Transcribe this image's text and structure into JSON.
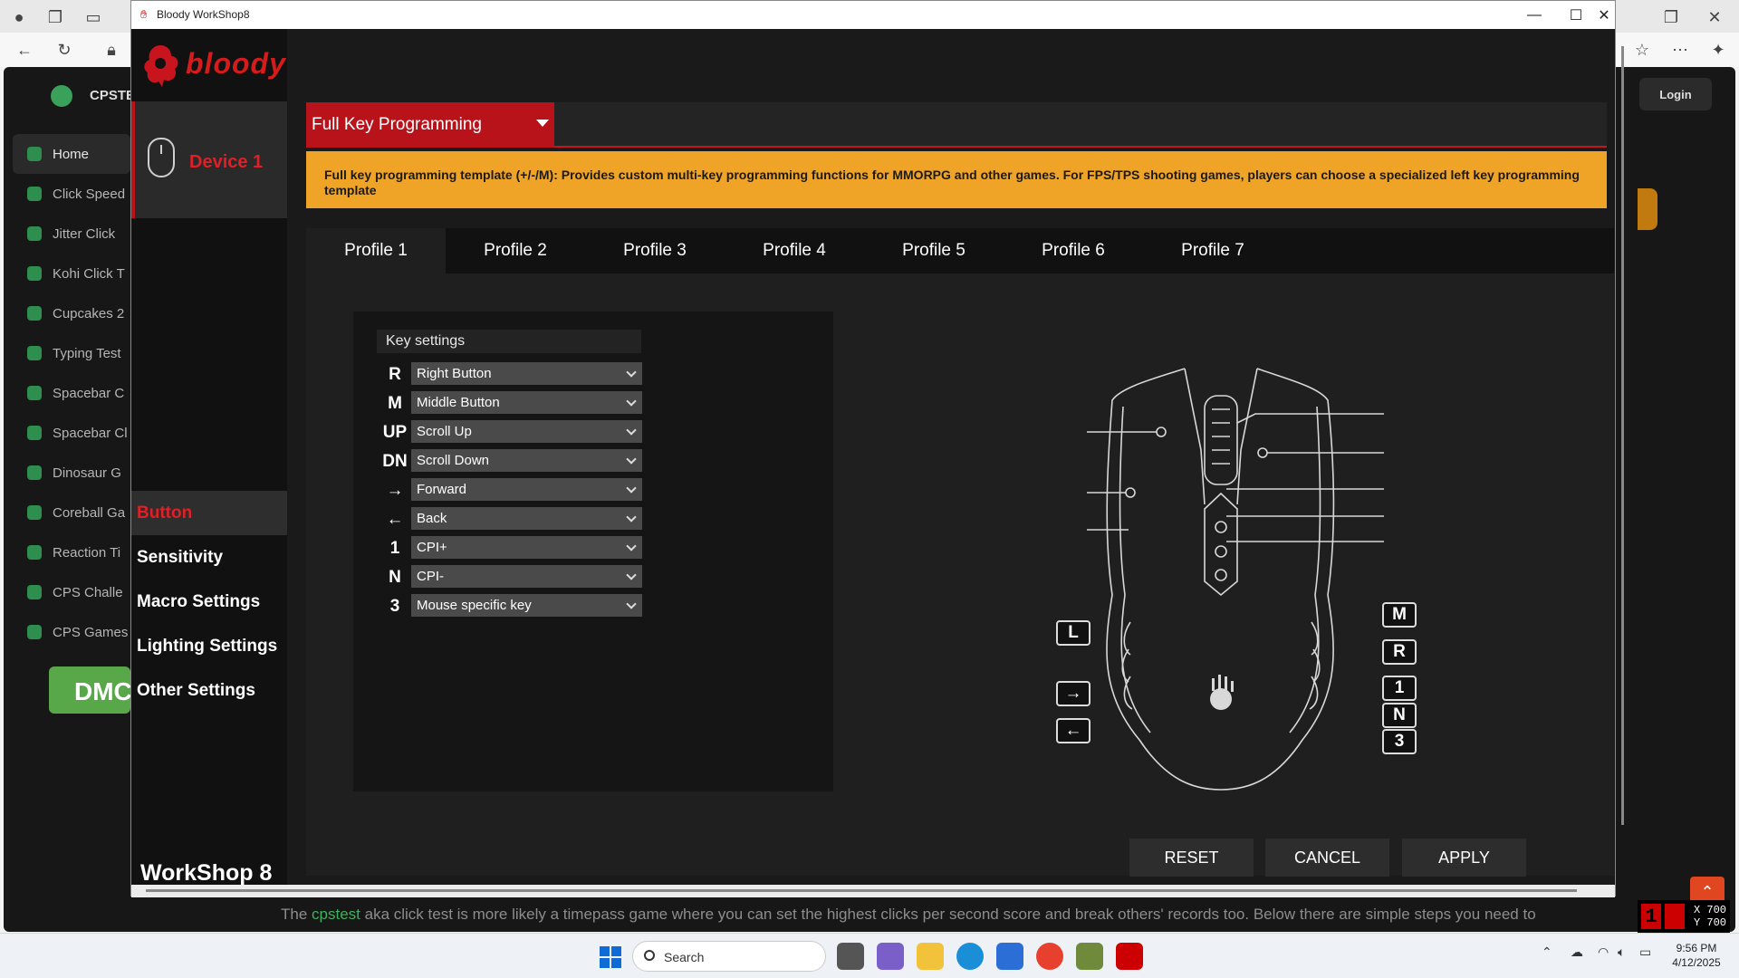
{
  "browser": {
    "site_title": "CPSTE",
    "login_label": "Login",
    "nav_items": [
      "Home",
      "Click Speed",
      "Jitter Click",
      "Kohi Click T",
      "Cupcakes 2",
      "Typing Test",
      "Spacebar C",
      "Spacebar Cl",
      "Dinosaur G",
      "Coreball Ga",
      "Reaction Ti",
      "CPS Challe",
      "CPS Games"
    ],
    "dmca_label": "DMC",
    "bottom_text_before": "The ",
    "bottom_text_link": "cpstest",
    "bottom_text_after": " aka click test is more likely a timepass game where you can set the highest clicks per second score and break others' records too. Below there are simple steps you need to",
    "coord_x": "X 700",
    "coord_y": "Y 700"
  },
  "window": {
    "title": "Bloody WorkShop8",
    "brand": "bloody",
    "device_label": "Device 1",
    "menu": [
      "Button",
      "Sensitivity",
      "Macro Settings",
      "Lighting Settings",
      "Other Settings"
    ],
    "active_menu": "Button",
    "footer_title": "WorkShop 8"
  },
  "template": {
    "selected": "Full Key Programming",
    "banner": "Full key programming template (+/-/M): Provides custom multi-key programming functions for MMORPG and other games.  For FPS/TPS shooting games, players can choose a specialized left key programming template"
  },
  "profiles": [
    "Profile 1",
    "Profile 2",
    "Profile 3",
    "Profile 4",
    "Profile 5",
    "Profile 6",
    "Profile 7"
  ],
  "active_profile": "Profile 1",
  "key_settings": {
    "header": "Key settings",
    "rows": [
      {
        "key": "R",
        "value": "Right Button"
      },
      {
        "key": "M",
        "value": "Middle Button"
      },
      {
        "key": "UP",
        "value": "Scroll Up"
      },
      {
        "key": "DN",
        "value": "Scroll Down"
      },
      {
        "key": "→",
        "value": "Forward"
      },
      {
        "key": "←",
        "value": "Back"
      },
      {
        "key": "1",
        "value": "CPI+"
      },
      {
        "key": "N",
        "value": "CPI-"
      },
      {
        "key": "3",
        "value": "Mouse specific key"
      }
    ]
  },
  "diagram_labels": {
    "L": "L",
    "M": "M",
    "R": "R",
    "forward": "→",
    "back": "←",
    "one": "1",
    "N": "N",
    "three": "3"
  },
  "actions": {
    "reset": "RESET",
    "cancel": "CANCEL",
    "apply": "APPLY"
  },
  "taskbar": {
    "search_placeholder": "Search",
    "time": "9:56 PM",
    "date": "4/12/2025"
  },
  "colors": {
    "accent_red": "#b8131b",
    "banner_orange": "#f0a427",
    "panel_dark": "#1f1f1f"
  }
}
